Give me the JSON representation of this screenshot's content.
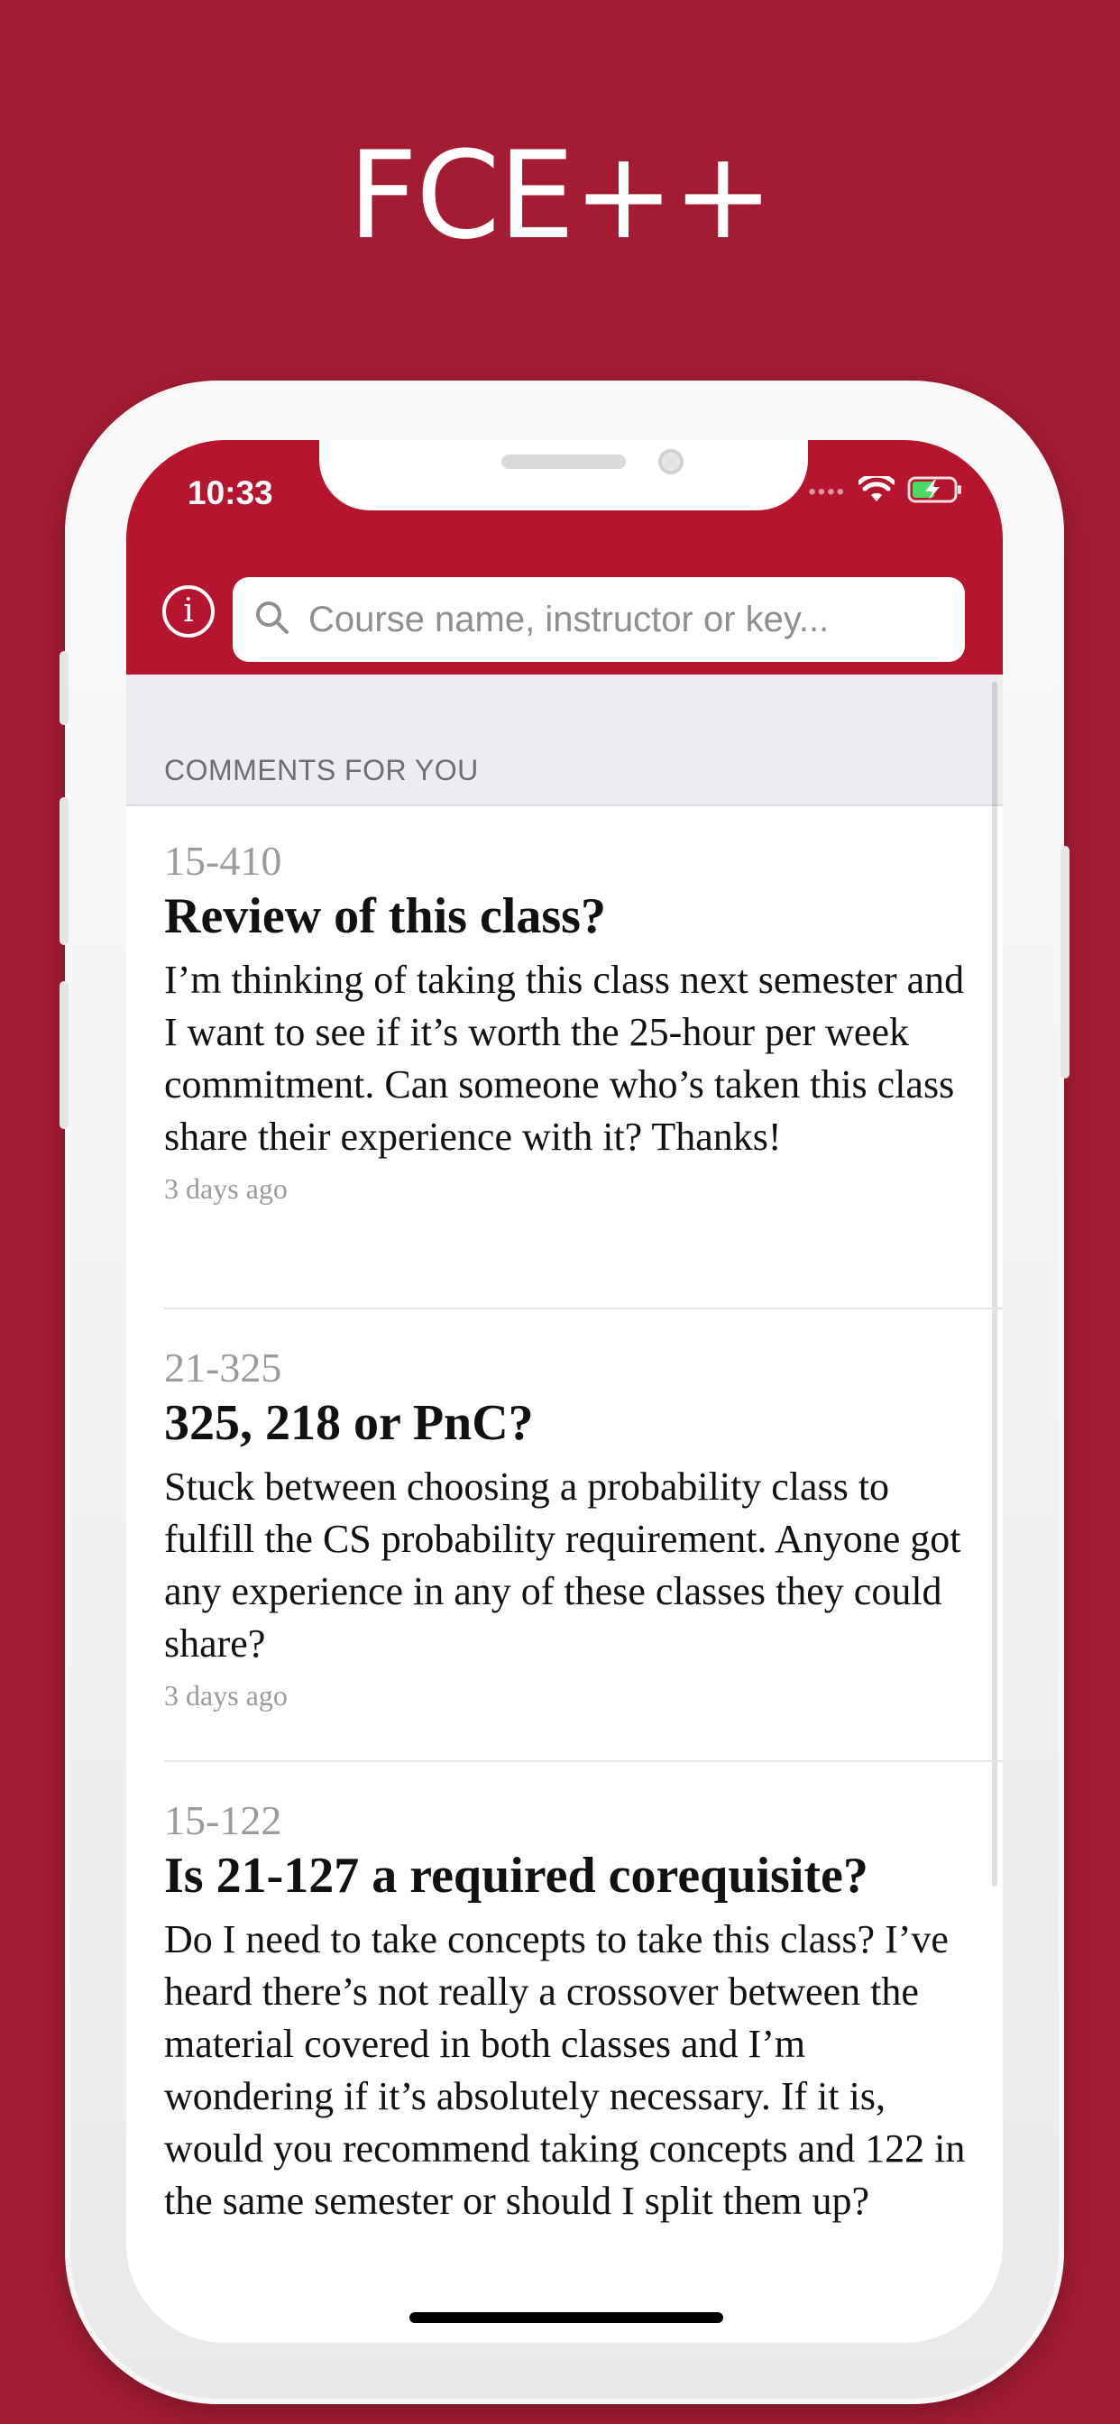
{
  "app_title": "FCE++",
  "status_bar": {
    "time": "10:33"
  },
  "search": {
    "placeholder": "Course name, instructor or key..."
  },
  "section": {
    "header": "COMMENTS FOR YOU"
  },
  "comments": [
    {
      "course": "15-410",
      "title": "Review of this class?",
      "body": "I’m thinking of taking this class next semester and I want to see if it’s worth the 25-hour per week commitment.  Can someone who’s taken this class share their experience with it?  Thanks!",
      "time": "3 days ago"
    },
    {
      "course": "21-325",
      "title": "325, 218 or PnC?",
      "body": "Stuck between choosing a probability class to fulfill the CS probability requirement.  Anyone got any experience in any of these classes they could share?",
      "time": "3 days ago"
    },
    {
      "course": "15-122",
      "title": "Is 21-127 a required corequisite?",
      "body": "Do I need to take concepts to take this class?  I’ve heard there’s not really a crossover between the material covered in both classes and I’m wondering if it’s absolutely necessary.  If it is, would you recommend taking concepts and 122 in the same semester or should I split them up?",
      "time": ""
    }
  ],
  "colors": {
    "background": "#A41C34",
    "accent": "#B5152E",
    "section_bg": "#EDEDF1",
    "muted_text": "#9B9B9B"
  },
  "icons": {
    "info": "info-icon",
    "search": "search-icon",
    "wifi": "wifi-icon",
    "battery": "battery-charging-icon"
  }
}
